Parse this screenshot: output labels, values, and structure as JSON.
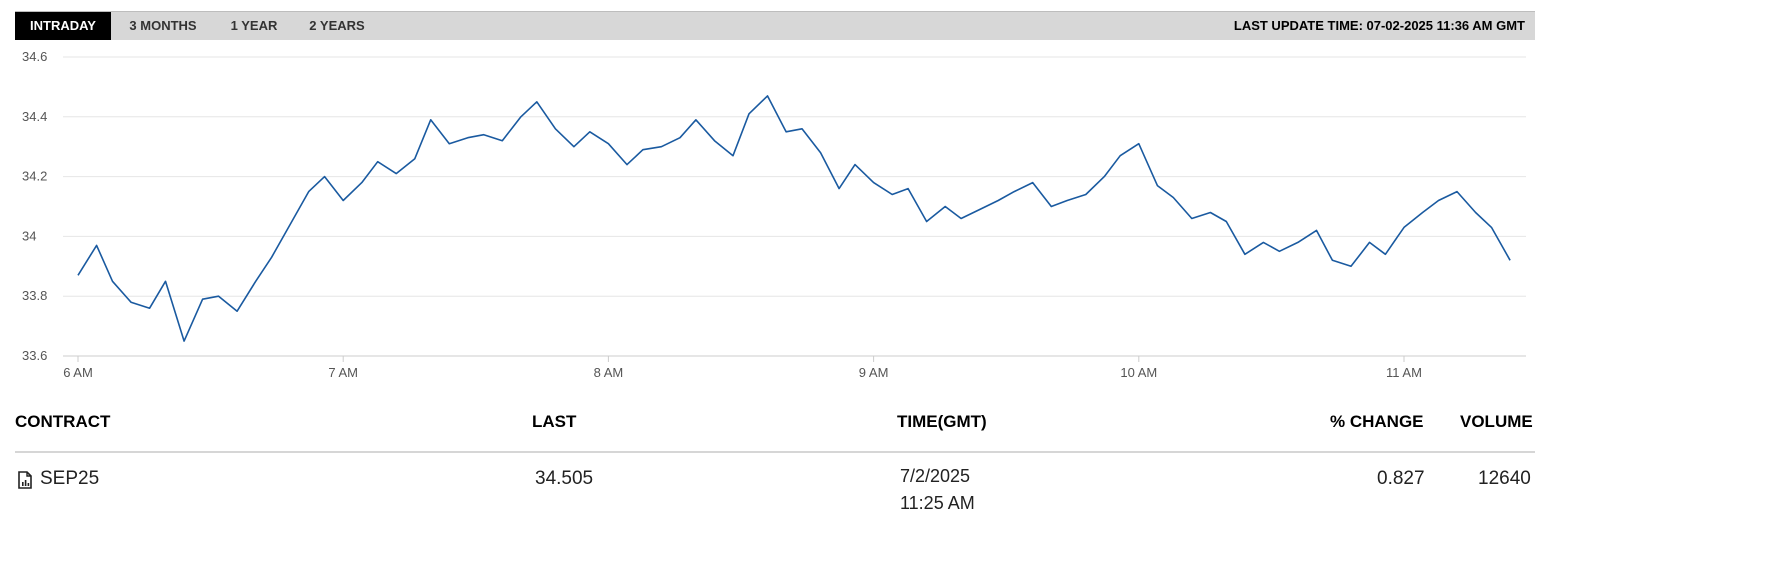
{
  "tabs": [
    {
      "label": "INTRADAY",
      "active": true
    },
    {
      "label": "3 MONTHS",
      "active": false
    },
    {
      "label": "1 YEAR",
      "active": false
    },
    {
      "label": "2 YEARS",
      "active": false
    }
  ],
  "last_update": "LAST UPDATE TIME: 07-02-2025 11:36 AM GMT",
  "colors": {
    "line": "#1a5aa0",
    "grid": "#e6e6e6",
    "axis": "#cccccc",
    "tab_active_bg": "#000000",
    "tab_bar_bg": "#d7d7d7"
  },
  "chart_data": {
    "type": "line",
    "x_tick_labels": [
      "6 AM",
      "7 AM",
      "8 AM",
      "9 AM",
      "10 AM",
      "11 AM"
    ],
    "y_tick_labels": [
      "34.6",
      "34.4",
      "34.2",
      "34",
      "33.8",
      "33.6"
    ],
    "ylim": [
      33.6,
      34.6
    ],
    "grid": true,
    "series": [
      {
        "x_hours": [
          6.0,
          6.07,
          6.13,
          6.2,
          6.27,
          6.33,
          6.4,
          6.47,
          6.53,
          6.6,
          6.67,
          6.73,
          6.8,
          6.87,
          6.93,
          7.0,
          7.07,
          7.13,
          7.2,
          7.27,
          7.33,
          7.4,
          7.47,
          7.53,
          7.6,
          7.67,
          7.73,
          7.8,
          7.87,
          7.93,
          8.0,
          8.07,
          8.13,
          8.2,
          8.27,
          8.33,
          8.4,
          8.47,
          8.53,
          8.6,
          8.67,
          8.73,
          8.8,
          8.87,
          8.93,
          9.0,
          9.07,
          9.13,
          9.2,
          9.27,
          9.33,
          9.4,
          9.47,
          9.53,
          9.6,
          9.67,
          9.73,
          9.8,
          9.87,
          9.93,
          10.0,
          10.07,
          10.13,
          10.2,
          10.27,
          10.33,
          10.4,
          10.47,
          10.53,
          10.6,
          10.67,
          10.73,
          10.8,
          10.87,
          10.93,
          11.0,
          11.07,
          11.13,
          11.2,
          11.27,
          11.33,
          11.4
        ],
        "y": [
          33.87,
          33.97,
          33.85,
          33.78,
          33.76,
          33.85,
          33.65,
          33.79,
          33.8,
          33.75,
          33.85,
          33.93,
          34.04,
          34.15,
          34.2,
          34.12,
          34.18,
          34.25,
          34.21,
          34.26,
          34.39,
          34.31,
          34.33,
          34.34,
          34.32,
          34.4,
          34.45,
          34.36,
          34.3,
          34.35,
          34.31,
          34.24,
          34.29,
          34.3,
          34.33,
          34.39,
          34.32,
          34.27,
          34.41,
          34.47,
          34.35,
          34.36,
          34.28,
          34.16,
          34.24,
          34.18,
          34.14,
          34.16,
          34.05,
          34.1,
          34.06,
          34.09,
          34.12,
          34.15,
          34.18,
          34.1,
          34.12,
          34.14,
          34.2,
          34.27,
          34.31,
          34.17,
          34.13,
          34.06,
          34.08,
          34.05,
          33.94,
          33.98,
          33.95,
          33.98,
          34.02,
          33.92,
          33.9,
          33.98,
          33.94,
          34.03,
          34.08,
          34.12,
          34.15,
          34.08,
          34.03,
          33.92
        ]
      }
    ]
  },
  "table": {
    "headers": [
      "CONTRACT",
      "LAST",
      "TIME(GMT)",
      "% CHANGE",
      "VOLUME"
    ],
    "row": {
      "contract": "SEP25",
      "last": "34.505",
      "date": "7/2/2025",
      "time": "11:25 AM",
      "change": "0.827",
      "volume": "12640"
    }
  }
}
